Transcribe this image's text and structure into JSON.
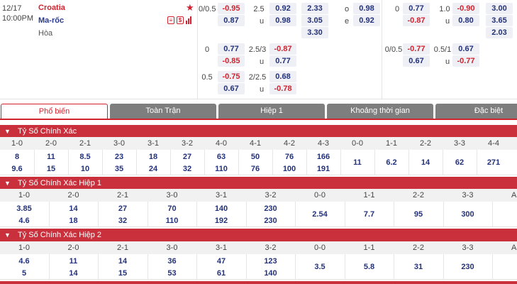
{
  "match": {
    "date": "12/17",
    "time": "10:00PM",
    "home": "Croatia",
    "away": "Ma-rốc",
    "draw": "Hòa",
    "icons": [
      "star-icon",
      "document-icon",
      "dollar-icon",
      "stats-icon"
    ],
    "icon_glyphs": {
      "doc": "≡",
      "dollar": "$"
    },
    "lines": [
      {
        "hcap": "0/0.5",
        "h1": "-0.95",
        "h2": "0.87",
        "ou": "2.5",
        "ou1": "0.92",
        "ou2": "0.98",
        "ou_u": "u",
        "x1": "2.33",
        "x2": "3.05",
        "x3": "3.30",
        "oe_o": "o",
        "oe1": "0.98",
        "oe_e": "e",
        "oe2": "0.92",
        "fh_hcap": "0",
        "fh1": "0.77",
        "fh2": "-0.87",
        "fh_ou": "1.0",
        "fhou1": "-0.90",
        "fh_u": "u",
        "fhou2": "0.80",
        "fx1": "3.00",
        "fx2": "3.65",
        "fx3": "2.03"
      },
      {
        "hcap": "0",
        "h1": "0.77",
        "h2": "-0.85",
        "ou": "2.5/3",
        "ou1": "-0.87",
        "ou_u": "u",
        "ou2": "0.77",
        "fh_hcap": "0/0.5",
        "fh1": "-0.77",
        "fh2": "0.67",
        "fh_ou": "0.5/1",
        "fhou1": "0.67",
        "fh_u": "u",
        "fhou2": "-0.77"
      },
      {
        "hcap": "0.5",
        "h1": "-0.75",
        "h2": "0.67",
        "ou": "2/2.5",
        "ou1": "0.68",
        "ou_u": "u",
        "ou2": "-0.78"
      }
    ]
  },
  "tabs": [
    "Phổ biến",
    "Toàn Trận",
    "Hiệp 1",
    "Khoảng thời gian",
    "Đặc biệt"
  ],
  "sections": [
    {
      "title": "Tỷ Số Chính Xác",
      "scores": [
        "1-0",
        "2-0",
        "2-1",
        "3-0",
        "3-1",
        "3-2",
        "4-0",
        "4-1",
        "4-2",
        "4-3",
        "0-0",
        "1-1",
        "2-2",
        "3-3",
        "4-4"
      ],
      "row1": [
        "8",
        "11",
        "8.5",
        "23",
        "18",
        "27",
        "63",
        "50",
        "76",
        "166"
      ],
      "row2": [
        "9.6",
        "15",
        "10",
        "35",
        "24",
        "32",
        "110",
        "76",
        "100",
        "191"
      ],
      "draws": [
        "11",
        "6.2",
        "14",
        "62",
        "271"
      ]
    },
    {
      "title": "Tỷ Số Chính Xác Hiệp 1",
      "scores": [
        "1-0",
        "2-0",
        "2-1",
        "3-0",
        "3-1",
        "3-2",
        "0-0",
        "1-1",
        "2-2",
        "3-3",
        "AO"
      ],
      "row1": [
        "3.85",
        "14",
        "27",
        "70",
        "140",
        "230"
      ],
      "row2": [
        "4.6",
        "18",
        "32",
        "110",
        "192",
        "230"
      ],
      "draws": [
        "2.54",
        "7.7",
        "95",
        "300"
      ]
    },
    {
      "title": "Tỷ Số Chính Xác Hiệp 2",
      "scores": [
        "1-0",
        "2-0",
        "2-1",
        "3-0",
        "3-1",
        "3-2",
        "0-0",
        "1-1",
        "2-2",
        "3-3",
        "AO"
      ],
      "row1": [
        "4.6",
        "11",
        "14",
        "36",
        "47",
        "123"
      ],
      "row2": [
        "5",
        "14",
        "15",
        "53",
        "61",
        "140"
      ],
      "draws": [
        "3.5",
        "5.8",
        "31",
        "230"
      ]
    }
  ],
  "colors": {
    "accent": "#c9303c",
    "odds_blue": "#23317a",
    "negative_red": "#d2222d",
    "tab_inactive": "#7e7e7e"
  }
}
